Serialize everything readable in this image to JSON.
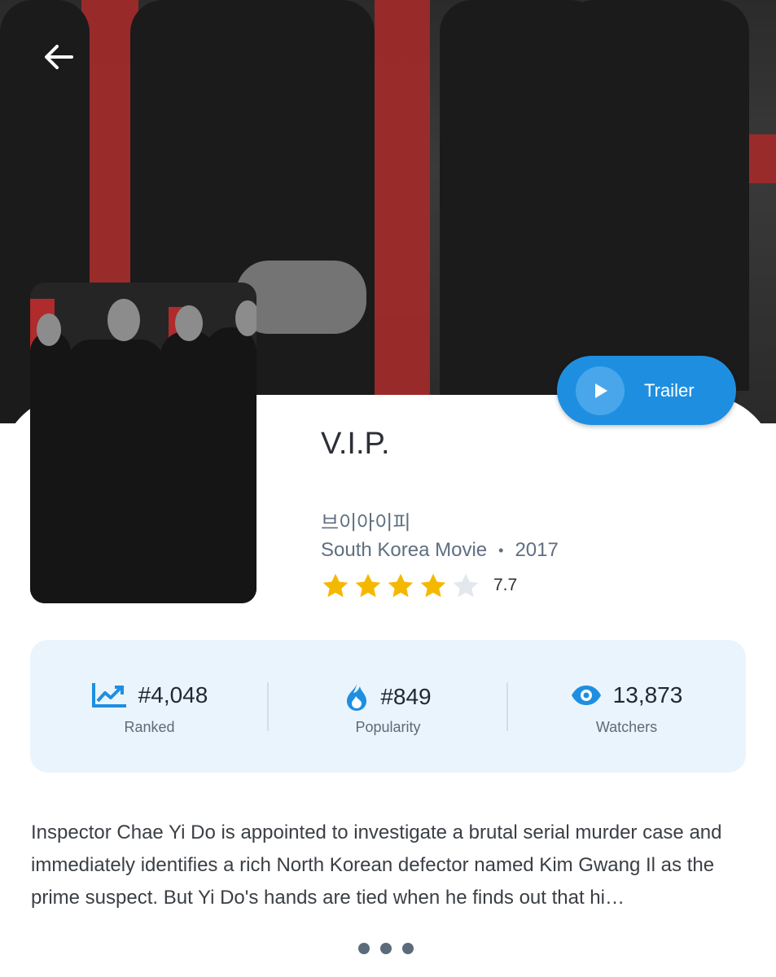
{
  "movie": {
    "title": "V.I.P.",
    "native_title": "브이아이피",
    "type_label": "South Korea Movie",
    "separator": "•",
    "year": "2017",
    "rating": {
      "value": 7.7,
      "label": "7.7",
      "stars_total": 5,
      "stars_filled": 4
    },
    "synopsis": "Inspector Chae Yi Do is appointed to investigate a brutal serial murder case and immediately identifies a rich North Korean defector named Kim Gwang Il as the prime suspect. But Yi Do's hands are tied when he finds out that hi…"
  },
  "trailer": {
    "label": "Trailer"
  },
  "stats": {
    "ranked": {
      "value": "#4,048",
      "caption": "Ranked",
      "icon": "trending-up-icon"
    },
    "popularity": {
      "value": "#849",
      "caption": "Popularity",
      "icon": "flame-icon"
    },
    "watchers": {
      "value": "13,873",
      "caption": "Watchers",
      "icon": "eye-icon"
    }
  },
  "colors": {
    "accent": "#1e8fe0",
    "star_filled": "#f5b800",
    "star_empty": "#e3e8ee",
    "stats_bg": "#eaf4fc"
  },
  "icons": {
    "back": "arrow-left-icon",
    "play": "play-icon",
    "more": "more-dots-icon"
  }
}
